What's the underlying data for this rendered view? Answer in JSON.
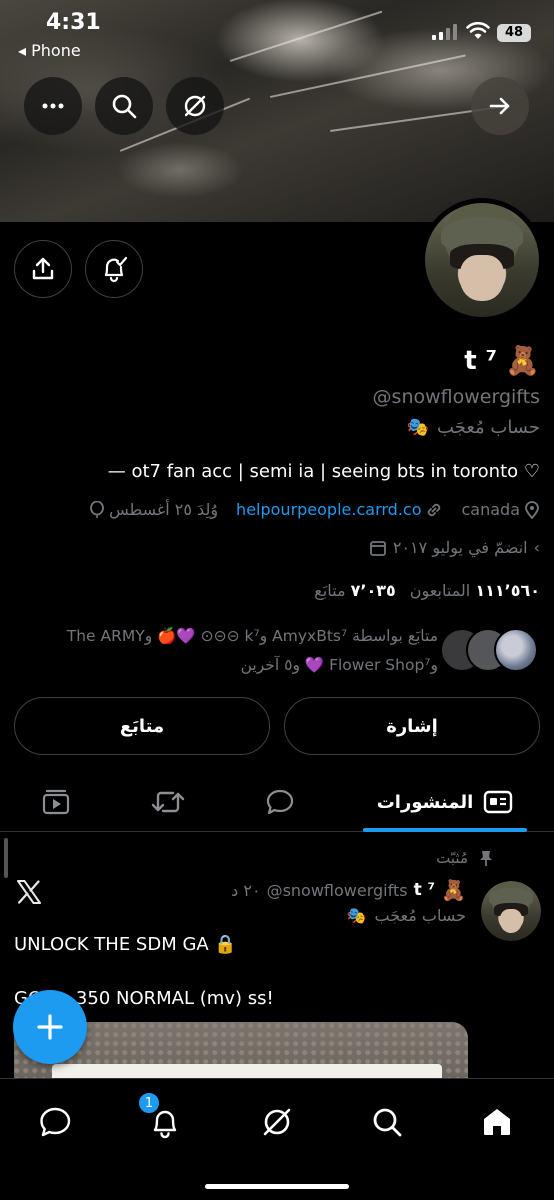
{
  "status_bar": {
    "time": "4:31",
    "back_app": "◂ Phone",
    "battery": "48"
  },
  "profile": {
    "display_name": "t ⁷",
    "name_emoji": "🧸",
    "handle": "@snowflowergifts",
    "parody_label": "حساب مُعجَب",
    "parody_emoji": "🎭",
    "bio": "— ot7 fan acc | semi ia | seeing bts in toronto ♡",
    "location": "canada",
    "website": "helpourpeople.carrd.co",
    "birthday": "وُلِدَ ٢٥ أغسطس",
    "joined": "انضمّ في يوليو ٢٠١٧",
    "following_count": "٧٬٠٣٥",
    "following_label": "متابَع",
    "followers_count": "١١١٬٥٦٠",
    "followers_label": "المتابعون",
    "followed_by": "متابَع بواسطة AmyxBts⁷ وk⁷ ⊝⊝⊙ 💜🍎 وThe ARMY وFlower Shop⁷ 💜 و٥ آخرين"
  },
  "actions": {
    "mention_label": "إشارة",
    "follow_label": "متابَع"
  },
  "tabs": [
    {
      "label": "المنشورات",
      "icon": "posts-icon",
      "active": true
    },
    {
      "label": "",
      "icon": "replies-icon"
    },
    {
      "label": "",
      "icon": "reposts-icon"
    },
    {
      "label": "",
      "icon": "media-icon"
    }
  ],
  "post": {
    "pinned_label": "مُثبّت",
    "author_name": "t ⁷",
    "author_emoji": "🧸",
    "author_handle": "@snowflowergifts",
    "time": "٢٠ د",
    "author_parody": "حساب مُعجَب",
    "line1": "UNLOCK THE SDM GA 🔒",
    "line2": "GOAL: 350 NORMAL (mv) ss!"
  },
  "bottom_nav": {
    "notifications_badge": "1"
  },
  "colors": {
    "accent": "#1d9bf0",
    "background": "#000000",
    "muted": "#71767b"
  }
}
